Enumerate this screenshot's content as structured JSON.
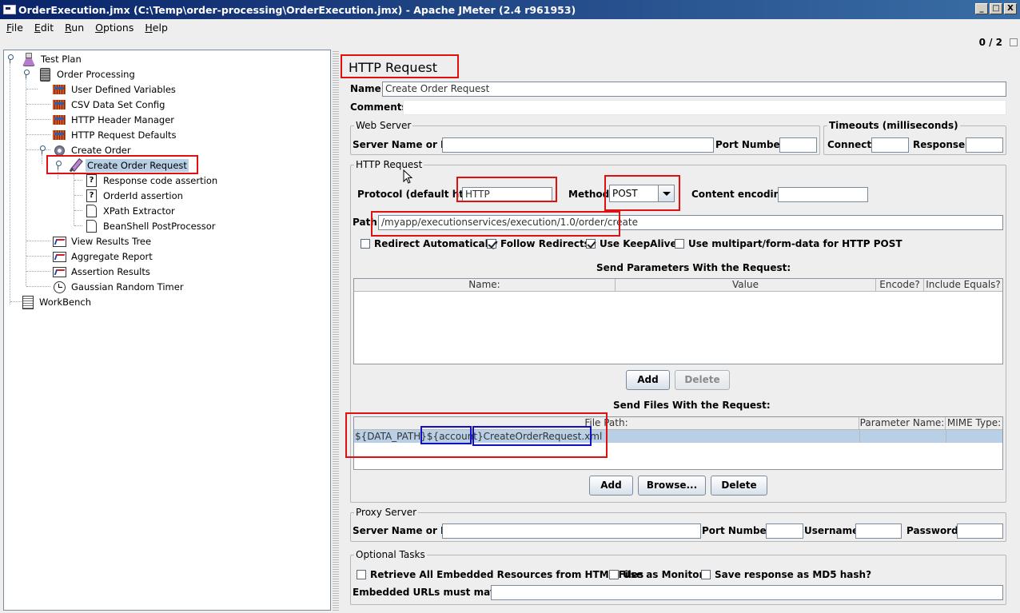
{
  "window": {
    "title": "OrderExecution.jmx (C:\\Temp\\order-processing\\OrderExecution.jmx) - Apache JMeter (2.4 r961953)",
    "minimize": "_",
    "maximize": "□",
    "close": "X"
  },
  "menu": {
    "file": {
      "mnemonic": "F",
      "rest": "ile"
    },
    "edit": {
      "mnemonic": "E",
      "rest": "dit"
    },
    "run": {
      "mnemonic": "R",
      "rest": "un"
    },
    "options": {
      "mnemonic": "O",
      "rest": "ptions"
    },
    "help": {
      "mnemonic": "H",
      "rest": "elp"
    }
  },
  "status": {
    "counter": "0 / 2"
  },
  "tree": {
    "items": [
      {
        "label": "Test Plan",
        "icon": "flask-icon"
      },
      {
        "label": "Order Processing",
        "icon": "thread-group-icon"
      },
      {
        "label": "User Defined Variables",
        "icon": "config-element-icon"
      },
      {
        "label": "CSV Data Set Config",
        "icon": "config-element-icon"
      },
      {
        "label": "HTTP Header Manager",
        "icon": "config-element-icon"
      },
      {
        "label": "HTTP Request Defaults",
        "icon": "config-element-icon"
      },
      {
        "label": "Create Order",
        "icon": "controller-icon"
      },
      {
        "label": "Create Order Request",
        "icon": "sampler-icon"
      },
      {
        "label": "Response code assertion",
        "icon": "assertion-icon"
      },
      {
        "label": "OrderId assertion",
        "icon": "assertion-icon"
      },
      {
        "label": "XPath Extractor",
        "icon": "post-processor-icon"
      },
      {
        "label": "BeanShell PostProcessor",
        "icon": "post-processor-icon"
      },
      {
        "label": "View Results Tree",
        "icon": "listener-icon"
      },
      {
        "label": "Aggregate Report",
        "icon": "listener-icon"
      },
      {
        "label": "Assertion Results",
        "icon": "listener-icon"
      },
      {
        "label": "Gaussian Random Timer",
        "icon": "timer-icon"
      },
      {
        "label": "WorkBench",
        "icon": "workbench-icon"
      }
    ],
    "selected": "Create Order Request"
  },
  "panel": {
    "title": "HTTP Request",
    "name_label": "Name:",
    "name_value": "Create Order Request",
    "comments_label": "Comments:",
    "web_server": {
      "legend": "Web Server",
      "server_label": "Server Name or IP:",
      "server_value": "",
      "port_label": "Port Number:",
      "port_value": ""
    },
    "timeouts": {
      "legend": "Timeouts (milliseconds)",
      "connect_label": "Connect:",
      "connect_value": "",
      "response_label": "Response:",
      "response_value": ""
    },
    "http_request": {
      "legend": "HTTP Request",
      "protocol_label": "Protocol (default http):",
      "protocol_value": "HTTP",
      "method_label": "Method:",
      "method_value": "POST",
      "encoding_label": "Content encoding:",
      "encoding_value": "",
      "path_label": "Path:",
      "path_value": "/myapp/executionservices/execution/1.0/order/create"
    },
    "options": {
      "redirect_auto": {
        "label": "Redirect Automatically",
        "checked": false
      },
      "follow_redirects": {
        "label": "Follow Redirects",
        "checked": true
      },
      "keepalive": {
        "label": "Use KeepAlive",
        "checked": true
      },
      "multipart": {
        "label": "Use multipart/form-data for HTTP POST",
        "checked": false
      }
    },
    "params": {
      "title": "Send Parameters With the Request:",
      "columns": [
        "Name:",
        "Value",
        "Encode?",
        "Include Equals?"
      ],
      "add": "Add",
      "delete": "Delete"
    },
    "files": {
      "title": "Send Files With the Request:",
      "columns": [
        "File Path:",
        "Parameter Name:",
        "MIME Type:"
      ],
      "row_part1": "${DATA_PATH}",
      "row_part2": "${account}",
      "row_part3": "CreateOrderRequest.xml",
      "add": "Add",
      "browse": "Browse...",
      "delete": "Delete"
    },
    "proxy": {
      "legend": "Proxy Server",
      "server_label": "Server Name or IP:",
      "port_label": "Port Number:",
      "username_label": "Username",
      "password_label": "Password"
    },
    "optional": {
      "legend": "Optional Tasks",
      "embedded": {
        "label": "Retrieve All Embedded Resources from HTML Files",
        "checked": false
      },
      "monitor": {
        "label": "Use as Monitor",
        "checked": false
      },
      "md5": {
        "label": "Save response as MD5 hash?",
        "checked": false
      },
      "urls_label": "Embedded URLs must match:"
    }
  },
  "colors": {
    "highlight_red": "#e01010",
    "highlight_blue": "#1010c0",
    "selection": "#b8cfe5"
  }
}
